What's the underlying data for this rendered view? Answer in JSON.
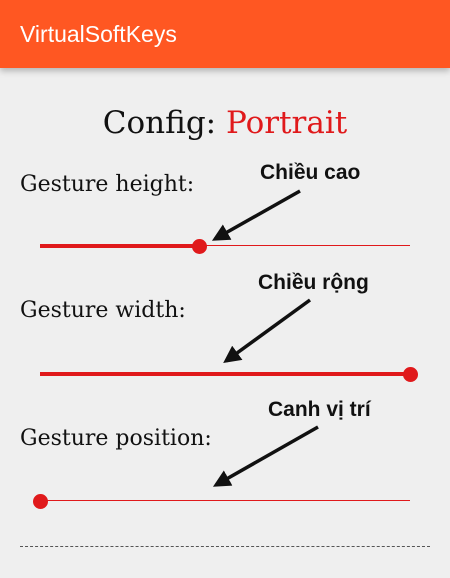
{
  "appbar": {
    "title": "VirtualSoftKeys",
    "color": "#ff5722"
  },
  "config": {
    "label": "Config:",
    "value": "Portrait",
    "value_color": "#e0191b"
  },
  "settings": [
    {
      "label": "Gesture height:",
      "level": 0.43,
      "annotation": "Chiều cao"
    },
    {
      "label": "Gesture width:",
      "level": 1.0,
      "annotation": "Chiều rộng"
    },
    {
      "label": "Gesture position:",
      "level": 0.0,
      "annotation": "Canh vị trí"
    }
  ],
  "accent_color": "#e0191b"
}
